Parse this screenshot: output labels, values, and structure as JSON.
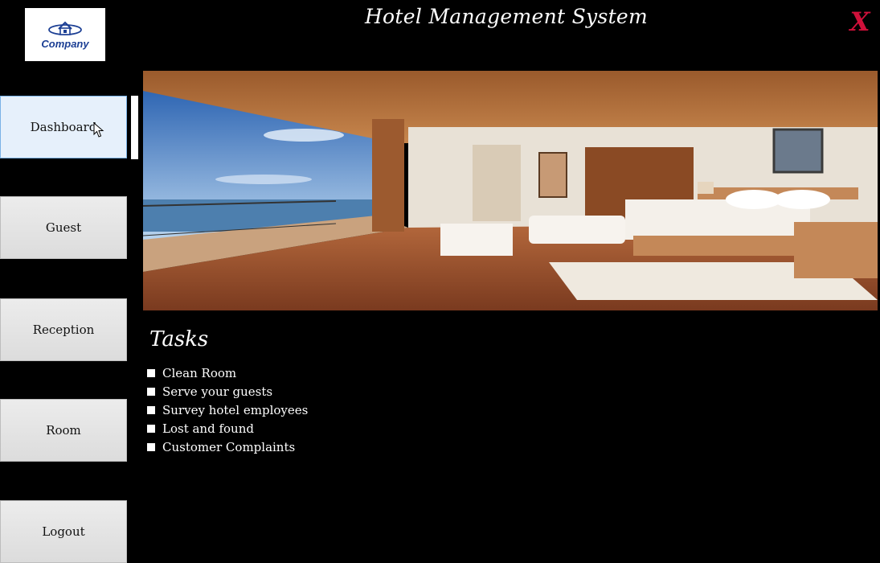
{
  "app": {
    "title": "Hotel Management System",
    "logo_text": "Company",
    "close_label": "X"
  },
  "sidebar": {
    "items": [
      {
        "label": "Dashboard",
        "active": true
      },
      {
        "label": "Guest"
      },
      {
        "label": "Reception"
      },
      {
        "label": "Room"
      },
      {
        "label": "Logout"
      }
    ]
  },
  "main": {
    "hero_image": "hotel-room-photo",
    "tasks_title": "Tasks",
    "tasks": [
      {
        "label": "Clean Room",
        "checked": false
      },
      {
        "label": "Serve your guests",
        "checked": false
      },
      {
        "label": "Survey hotel employees",
        "checked": false
      },
      {
        "label": "Lost and found",
        "checked": false
      },
      {
        "label": "Customer Complaints",
        "checked": false
      }
    ]
  },
  "colors": {
    "background": "#000000",
    "close_accent": "#d0103a",
    "logo_blue": "#1c3f94",
    "active_nav": "#e6f0fb"
  }
}
